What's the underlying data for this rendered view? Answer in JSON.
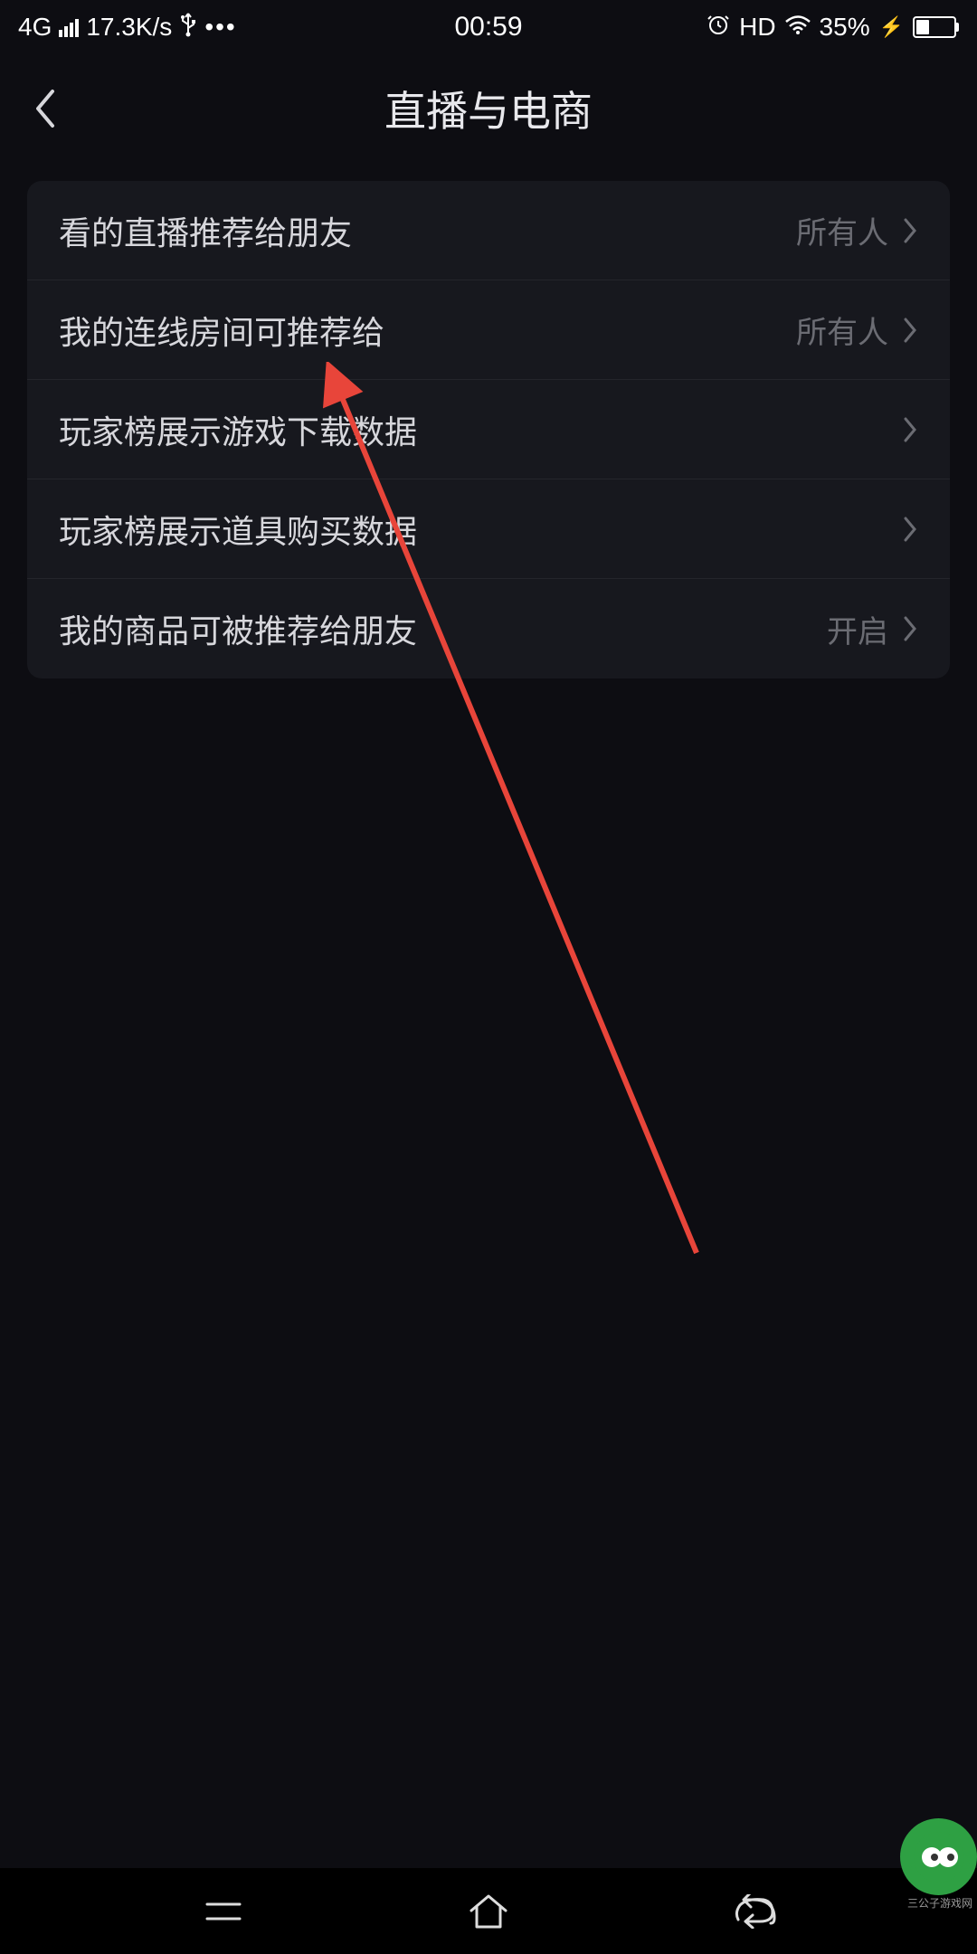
{
  "statusBar": {
    "network": "4G",
    "speed": "17.3K/s",
    "time": "00:59",
    "hd": "HD",
    "battery": "35%"
  },
  "header": {
    "title": "直播与电商"
  },
  "settings": {
    "items": [
      {
        "label": "看的直播推荐给朋友",
        "value": "所有人"
      },
      {
        "label": "我的连线房间可推荐给",
        "value": "所有人"
      },
      {
        "label": "玩家榜展示游戏下载数据",
        "value": ""
      },
      {
        "label": "玩家榜展示道具购买数据",
        "value": ""
      },
      {
        "label": "我的商品可被推荐给朋友",
        "value": "开启"
      }
    ]
  },
  "watermark": {
    "name": "三公子游戏网"
  }
}
